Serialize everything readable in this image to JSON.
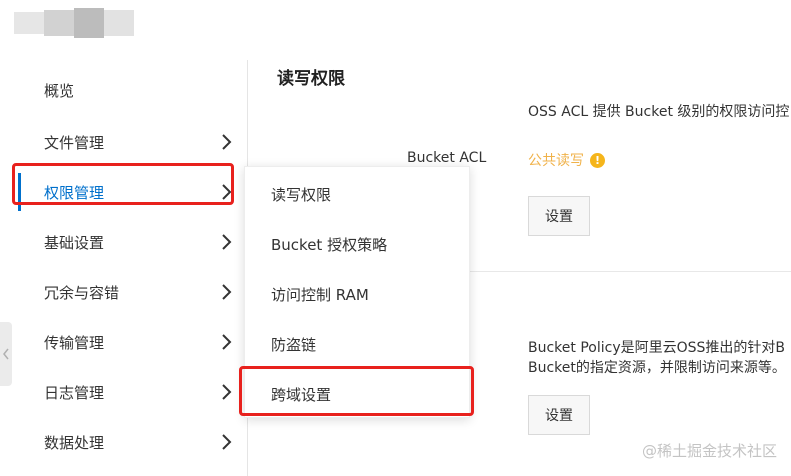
{
  "sidebar": {
    "items": [
      {
        "label": "概览",
        "has_arrow": false
      },
      {
        "label": "文件管理",
        "has_arrow": true
      },
      {
        "label": "权限管理",
        "has_arrow": true
      },
      {
        "label": "基础设置",
        "has_arrow": true
      },
      {
        "label": "冗余与容错",
        "has_arrow": true
      },
      {
        "label": "传输管理",
        "has_arrow": true
      },
      {
        "label": "日志管理",
        "has_arrow": true
      },
      {
        "label": "数据处理",
        "has_arrow": true
      }
    ],
    "active_index": 2
  },
  "submenu": {
    "items": [
      {
        "label": "读写权限"
      },
      {
        "label": "Bucket 授权策略"
      },
      {
        "label": "访问控制 RAM"
      },
      {
        "label": "防盗链"
      },
      {
        "label": "跨域设置"
      }
    ]
  },
  "main": {
    "section_title": "读写权限",
    "acl_description": "OSS ACL 提供 Bucket 级别的权限访问控",
    "acl_label": "Bucket ACL",
    "acl_value": "公共读写",
    "warning_icon": "warning-icon",
    "settings_label_1": "设置",
    "policy_description_line1": "Bucket Policy是阿里云OSS推出的针对B",
    "policy_description_line2": "Bucket的指定资源，并限制访问来源等。",
    "settings_label_2": "设置"
  },
  "watermark": "@稀土掘金技术社区",
  "colors": {
    "accent": "#0070cc",
    "highlight": "#e8211d",
    "warning": "#f5b51b",
    "acl_value_text": "#f0b24a"
  }
}
